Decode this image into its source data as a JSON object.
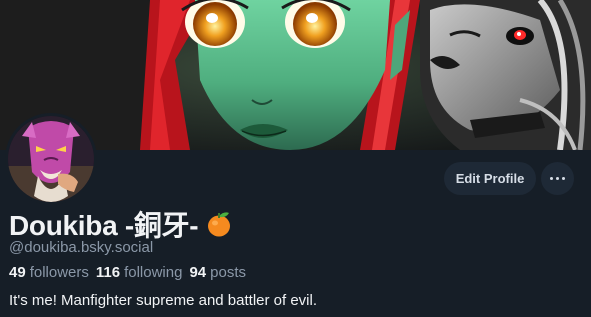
{
  "profile": {
    "display_name": "Doukiba -銅牙-",
    "handle": "@doukiba.bsky.social",
    "bio": "It's me! Manfighter supreme and battler of evil.",
    "stats": {
      "followers_count": "49",
      "followers_label": "followers",
      "following_count": "116",
      "following_label": "following",
      "posts_count": "94",
      "posts_label": "posts"
    }
  },
  "actions": {
    "edit_profile_label": "Edit Profile",
    "more_icon": "ellipsis-icon"
  },
  "colors": {
    "background": "#161e27",
    "button_bg": "#1e2936",
    "muted_text": "#8b98a8",
    "primary_text": "#f1f3f5"
  }
}
